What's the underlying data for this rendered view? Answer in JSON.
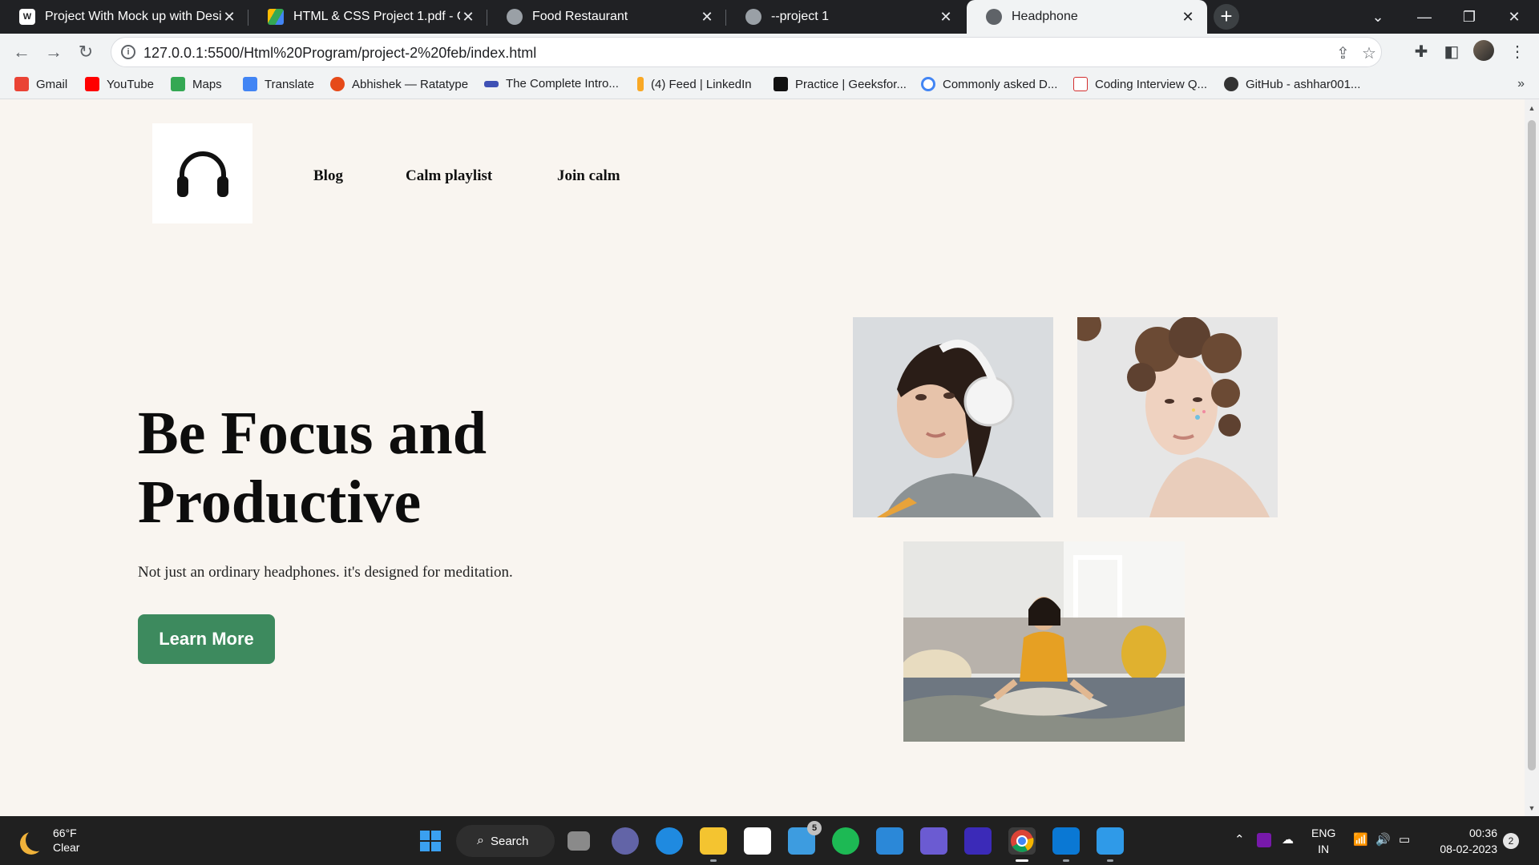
{
  "browser": {
    "tabs": [
      {
        "title": "Project With Mock up with Desig",
        "active": false
      },
      {
        "title": "HTML & CSS Project 1.pdf - Goo",
        "active": false
      },
      {
        "title": "Food Restaurant",
        "active": false
      },
      {
        "title": "--project 1",
        "active": false
      },
      {
        "title": "Headphone",
        "active": true
      }
    ],
    "url": "127.0.0.1:5500/Html%20Program/project-2%20feb/index.html",
    "bookmarks": [
      {
        "label": "Gmail",
        "color": "#ea4335"
      },
      {
        "label": "YouTube",
        "color": "#ff0000"
      },
      {
        "label": "Maps",
        "color": "#34a853"
      },
      {
        "label": "Translate",
        "color": "#4285f4"
      },
      {
        "label": "Abhishek — Ratatype",
        "color": "#e64a19"
      },
      {
        "label": "The Complete Intro...",
        "color": "#3f51b5"
      },
      {
        "label": "(4) Feed | LinkedIn",
        "color": "#f9a825"
      },
      {
        "label": "Practice | Geeksfor...",
        "color": "#111111"
      },
      {
        "label": "Commonly asked D...",
        "color": "#4285f4"
      },
      {
        "label": "Coding Interview Q...",
        "color": "#d32f2f"
      },
      {
        "label": "GitHub - ashhar001...",
        "color": "#333333"
      }
    ]
  },
  "page": {
    "logo_icon": "headphones-icon",
    "nav": [
      "Blog",
      "Calm playlist",
      "Join calm"
    ],
    "hero": {
      "title": "Be Focus and Productive",
      "subtitle": "Not just an ordinary headphones. it's designed for meditation.",
      "button_label": "Learn More",
      "button_color": "#3d8a5e"
    },
    "background_color": "#f9f5f0"
  },
  "taskbar": {
    "weather": {
      "temp": "66°F",
      "condition": "Clear"
    },
    "search_label": "Search",
    "mail_badge": "5",
    "language": {
      "line1": "ENG",
      "line2": "IN"
    },
    "time": "00:36",
    "date": "08-02-2023",
    "notifications": "2"
  }
}
